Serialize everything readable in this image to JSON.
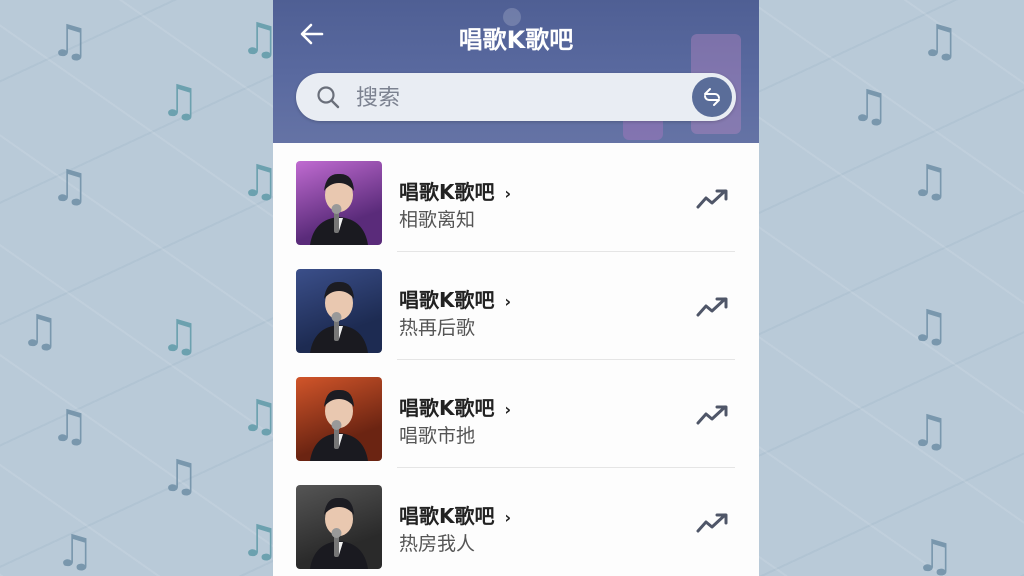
{
  "header": {
    "title": "唱歌K歌吧",
    "back_icon": "back-arrow-icon"
  },
  "search": {
    "placeholder": "搜索",
    "scan_icon": "scan-refresh-icon"
  },
  "songs": [
    {
      "title": "唱歌K歌吧",
      "subtitle": "相歌离知",
      "palette": [
        "#5a2b7a",
        "#c06bd1"
      ]
    },
    {
      "title": "唱歌K歌吧",
      "subtitle": "热再后歌",
      "palette": [
        "#1d2b52",
        "#3b4f8a"
      ]
    },
    {
      "title": "唱歌K歌吧",
      "subtitle": "唱歌市扡",
      "palette": [
        "#6b2412",
        "#d1552a"
      ]
    },
    {
      "title": "唱歌K歌吧",
      "subtitle": "热房我人",
      "palette": [
        "#2a2a2a",
        "#555555"
      ]
    }
  ],
  "icons": {
    "chevron": "›",
    "trend": "trend-up-icon",
    "music": "♫"
  },
  "colors": {
    "header": "#5a6aa0",
    "background": "#b9cad8"
  }
}
